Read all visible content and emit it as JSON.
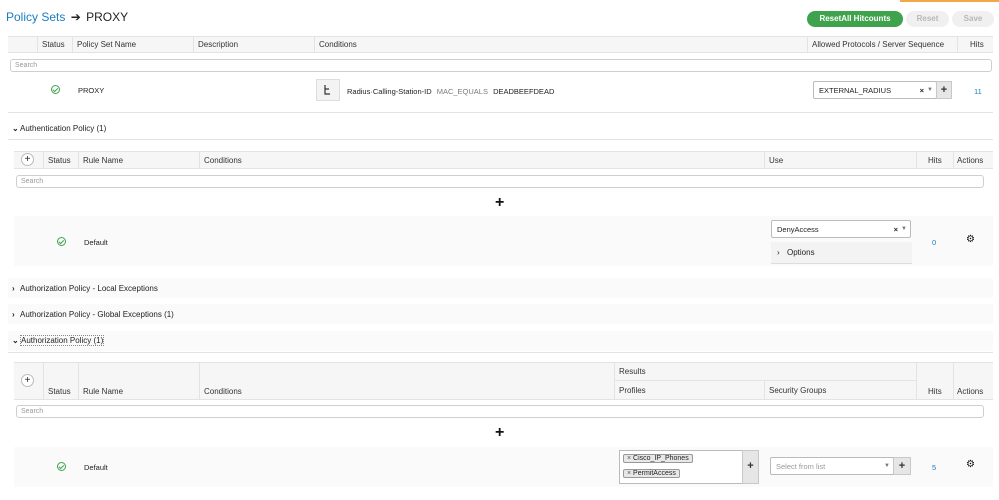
{
  "breadcrumb": {
    "link": "Policy Sets",
    "arrow": "➔",
    "current": "PROXY"
  },
  "toolbar": {
    "reset_hitcounts": "ResetAll Hitcounts",
    "reset": "Reset",
    "save": "Save"
  },
  "policy_sets_table": {
    "headers": {
      "status": "Status",
      "name": "Policy Set Name",
      "description": "Description",
      "conditions": "Conditions",
      "protocols": "Allowed Protocols / Server Sequence",
      "hits": "Hits"
    },
    "search_placeholder": "Search",
    "row": {
      "status": "enabled",
      "name": "PROXY",
      "condition_attribute": "Radius·Calling-Station-ID",
      "condition_operator": "MAC_EQUALS",
      "condition_value": "DEADBEEFDEAD",
      "protocol": "EXTERNAL_RADIUS",
      "hits": "11"
    }
  },
  "authentication_policy": {
    "title": "Authentication Policy (1)",
    "headers": {
      "status": "Status",
      "rule_name": "Rule Name",
      "conditions": "Conditions",
      "use": "Use",
      "hits": "Hits",
      "actions": "Actions"
    },
    "search_placeholder": "Search",
    "row": {
      "name": "Default",
      "use": "DenyAccess",
      "options": "Options",
      "hits": "0"
    }
  },
  "authz_local_exceptions": {
    "title": "Authorization Policy - Local Exceptions"
  },
  "authz_global_exceptions": {
    "title": "Authorization Policy - Global Exceptions (1)"
  },
  "authorization_policy": {
    "title": "Authorization Policy (1)",
    "headers": {
      "results": "Results",
      "status": "Status",
      "rule_name": "Rule Name",
      "conditions": "Conditions",
      "profiles": "Profiles",
      "security_groups": "Security Groups",
      "hits": "Hits",
      "actions": "Actions"
    },
    "search_placeholder": "Search",
    "row": {
      "name": "Default",
      "profiles": [
        "Cisco_IP_Phones",
        "PermitAccess"
      ],
      "security_groups_placeholder": "Select from list",
      "hits": "5"
    }
  },
  "colors": {
    "link": "#1a7cc1",
    "primary_button": "#3fa34d",
    "status_ok": "#3fa34d",
    "accent": "#f1a74a"
  }
}
